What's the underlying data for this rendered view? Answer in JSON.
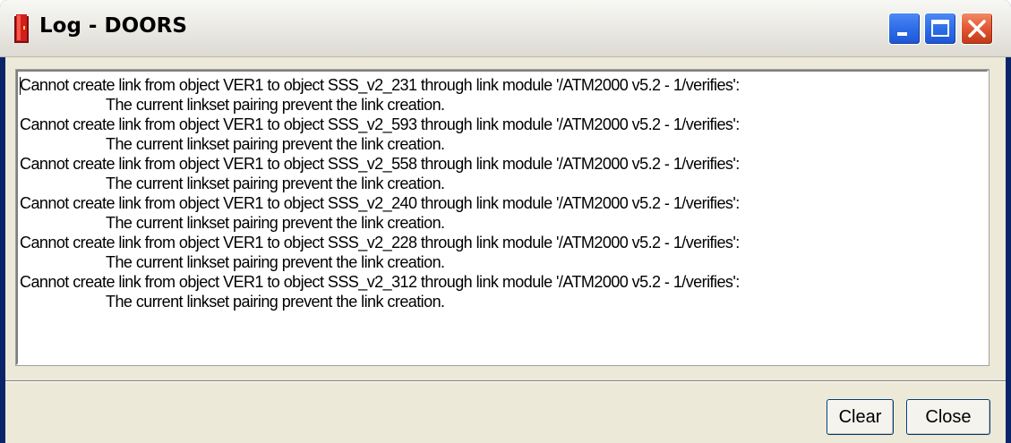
{
  "window": {
    "title": "Log - DOORS"
  },
  "log": {
    "lines": [
      "Cannot create link from  object VER1 to object SSS_v2_231 through link module '/ATM2000 v5.2 - 1/verifies':",
      "The current linkset pairing prevent the link creation.",
      "Cannot create link from  object VER1 to object SSS_v2_593 through link module '/ATM2000 v5.2 - 1/verifies':",
      "The current linkset pairing prevent the link creation.",
      "Cannot create link from  object VER1 to object SSS_v2_558 through link module '/ATM2000 v5.2 - 1/verifies':",
      "The current linkset pairing prevent the link creation.",
      "Cannot create link from  object VER1 to object SSS_v2_240 through link module '/ATM2000 v5.2 - 1/verifies':",
      "The current linkset pairing prevent the link creation.",
      "Cannot create link from  object VER1 to object SSS_v2_228 through link module '/ATM2000 v5.2 - 1/verifies':",
      "The current linkset pairing prevent the link creation.",
      "Cannot create link from  object VER1 to object SSS_v2_312 through link module '/ATM2000 v5.2 - 1/verifies':",
      "The current linkset pairing prevent the link creation."
    ]
  },
  "buttons": {
    "clear_label": "Clear",
    "close_label": "Close"
  },
  "icons": {
    "app": "doors-icon",
    "minimize": "minimize-icon",
    "maximize": "maximize-icon",
    "close": "close-icon"
  },
  "colors": {
    "close_button": "#e0512f",
    "caption_buttons": "#2e6de8",
    "dialog_background": "#ece9d8"
  }
}
